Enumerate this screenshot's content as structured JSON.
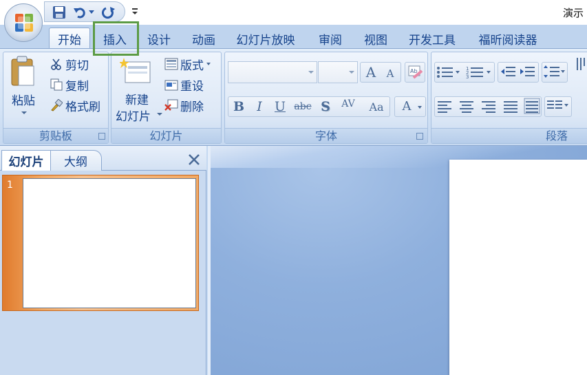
{
  "window": {
    "title": "演示"
  },
  "tabs": [
    {
      "label": "开始",
      "active": true
    },
    {
      "label": "插入",
      "highlighted": true
    },
    {
      "label": "设计"
    },
    {
      "label": "动画"
    },
    {
      "label": "幻灯片放映"
    },
    {
      "label": "审阅"
    },
    {
      "label": "视图"
    },
    {
      "label": "开发工具"
    },
    {
      "label": "福昕阅读器"
    }
  ],
  "ribbon": {
    "clipboard": {
      "label": "剪贴板",
      "paste": "粘贴",
      "cut": "剪切",
      "copy": "复制",
      "format_painter": "格式刷"
    },
    "slides": {
      "label": "幻灯片",
      "new_slide_line1": "新建",
      "new_slide_line2": "幻灯片",
      "layout": "版式",
      "reset": "重设",
      "delete": "删除"
    },
    "font": {
      "label": "字体",
      "font_name": "",
      "font_size": "",
      "bold": "B",
      "italic": "I",
      "underline": "U",
      "strikethrough": "abc",
      "shadow": "S",
      "spacing": "AV",
      "change_case": "Aa",
      "color": "A",
      "grow": "A",
      "shrink": "A"
    },
    "paragraph": {
      "label": "段落"
    }
  },
  "left_pane": {
    "tab_slides": "幻灯片",
    "tab_outline": "大纲",
    "slides": [
      {
        "number": "1"
      }
    ]
  },
  "colors": {
    "accent": "#15428b",
    "highlight_box": "#5b9b44",
    "selected_thumb": "#e07b2d",
    "ribbon_bg": "#dde8f6"
  }
}
